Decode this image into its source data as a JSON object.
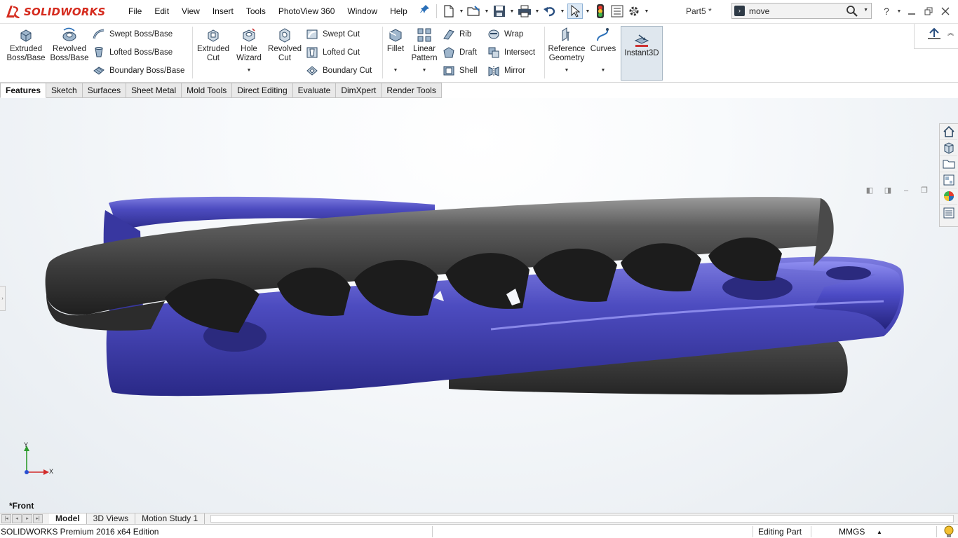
{
  "app": {
    "brand": "SOLIDWORKS",
    "document": "Part5 *"
  },
  "menu": [
    "File",
    "Edit",
    "View",
    "Insert",
    "Tools",
    "PhotoView 360",
    "Window",
    "Help"
  ],
  "search": {
    "value": "move",
    "placeholder": ""
  },
  "ribbon": {
    "extruded_boss": [
      "Extruded",
      "Boss/Base"
    ],
    "revolved_boss": [
      "Revolved",
      "Boss/Base"
    ],
    "swept_boss": "Swept Boss/Base",
    "lofted_boss": "Lofted Boss/Base",
    "boundary_boss": "Boundary Boss/Base",
    "extruded_cut": [
      "Extruded",
      "Cut"
    ],
    "hole_wizard": [
      "Hole",
      "Wizard"
    ],
    "revolved_cut": [
      "Revolved",
      "Cut"
    ],
    "swept_cut": "Swept Cut",
    "lofted_cut": "Lofted Cut",
    "boundary_cut": "Boundary Cut",
    "fillet": "Fillet",
    "linear_pattern": [
      "Linear",
      "Pattern"
    ],
    "rib": "Rib",
    "draft": "Draft",
    "shell": "Shell",
    "wrap": "Wrap",
    "intersect": "Intersect",
    "mirror": "Mirror",
    "reference_geometry": [
      "Reference",
      "Geometry"
    ],
    "curves": "Curves",
    "instant3d": "Instant3D"
  },
  "tabs": [
    {
      "label": "Features",
      "active": true
    },
    {
      "label": "Sketch",
      "active": false
    },
    {
      "label": "Surfaces",
      "active": false
    },
    {
      "label": "Sheet Metal",
      "active": false
    },
    {
      "label": "Mold Tools",
      "active": false
    },
    {
      "label": "Direct Editing",
      "active": false
    },
    {
      "label": "Evaluate",
      "active": false
    },
    {
      "label": "DimXpert",
      "active": false
    },
    {
      "label": "Render Tools",
      "active": false
    }
  ],
  "viewport": {
    "view_name": "*Front",
    "triad": {
      "x": "X",
      "y": "Y"
    },
    "colors": {
      "part_gray": "#3d3d3d",
      "part_blue": "#4a48b5",
      "background": "#eef2f6"
    }
  },
  "bottom_tabs": [
    {
      "label": "Model",
      "active": true
    },
    {
      "label": "3D Views",
      "active": false
    },
    {
      "label": "Motion Study 1",
      "active": false
    }
  ],
  "status": {
    "edition": "SOLIDWORKS Premium 2016 x64 Edition",
    "mode": "Editing Part",
    "units": "MMGS"
  }
}
